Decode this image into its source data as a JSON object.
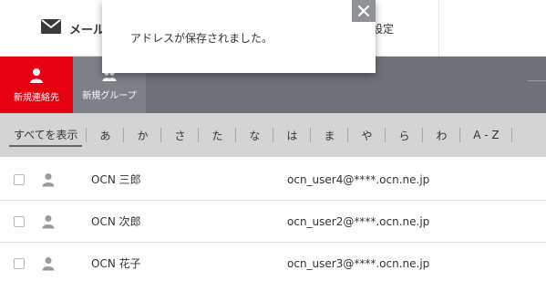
{
  "nav": {
    "mail_label": "メール",
    "settings_label": "設定"
  },
  "toolbar": {
    "new_contact_label": "新規連絡先",
    "new_group_label": "新規グループ"
  },
  "index": {
    "all_label": "すべてを表示",
    "keys": [
      "あ",
      "か",
      "さ",
      "た",
      "な",
      "は",
      "ま",
      "や",
      "ら",
      "わ"
    ],
    "az_label": "A - Z"
  },
  "contacts": [
    {
      "name": "OCN 三郎",
      "email": "ocn_user4@****.ocn.ne.jp"
    },
    {
      "name": "OCN 次郎",
      "email": "ocn_user2@****.ocn.ne.jp"
    },
    {
      "name": "OCN 花子",
      "email": "ocn_user3@****.ocn.ne.jp"
    }
  ],
  "toast": {
    "message": "アドレスが保存されました。"
  },
  "colors": {
    "accent": "#e60012",
    "toolbar": "#6e7177",
    "indexbar": "#d4d4d4"
  }
}
